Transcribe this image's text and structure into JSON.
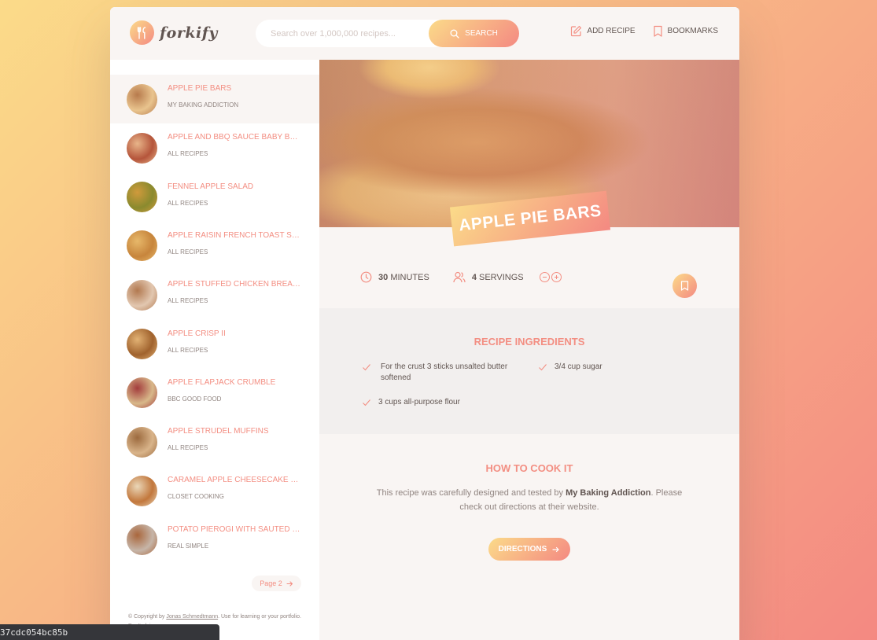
{
  "brand": {
    "name": "forkify"
  },
  "search": {
    "placeholder": "Search over 1,000,000 recipes...",
    "button_label": "SEARCH"
  },
  "nav": {
    "add_recipe": "ADD RECIPE",
    "bookmarks": "BOOKMARKS"
  },
  "results": [
    {
      "title": "APPLE PIE BARS",
      "publisher": "MY BAKING ADDICTION",
      "active": true,
      "thumb": [
        "#e9c48e",
        "#b77a4c"
      ]
    },
    {
      "title": "APPLE AND BBQ SAUCE BABY BA...",
      "publisher": "ALL RECIPES",
      "thumb": [
        "#b5553b",
        "#e8b58a"
      ]
    },
    {
      "title": "FENNEL APPLE SALAD",
      "publisher": "ALL RECIPES",
      "thumb": [
        "#8a8a2e",
        "#d09a3c"
      ]
    },
    {
      "title": "APPLE RAISIN FRENCH TOAST ST...",
      "publisher": "ALL RECIPES",
      "thumb": [
        "#c7853c",
        "#e7b86a"
      ]
    },
    {
      "title": "APPLE STUFFED CHICKEN BREAST",
      "publisher": "ALL RECIPES",
      "thumb": [
        "#e2c7b0",
        "#b27950"
      ]
    },
    {
      "title": "APPLE CRISP II",
      "publisher": "ALL RECIPES",
      "thumb": [
        "#a0622d",
        "#e2b274"
      ]
    },
    {
      "title": "APPLE FLAPJACK CRUMBLE",
      "publisher": "BBC GOOD FOOD",
      "thumb": [
        "#d8b88a",
        "#a33c3c"
      ]
    },
    {
      "title": "APPLE STRUDEL MUFFINS",
      "publisher": "ALL RECIPES",
      "thumb": [
        "#d9b48a",
        "#9c6a3e"
      ]
    },
    {
      "title": "CARAMEL APPLE CHEESECAKE B...",
      "publisher": "CLOSET COOKING",
      "thumb": [
        "#c2773c",
        "#ead7b8"
      ]
    },
    {
      "title": "POTATO PIEROGI WITH SAUTED C...",
      "publisher": "REAL SIMPLE",
      "thumb": [
        "#c6b5a8",
        "#a9663c"
      ]
    }
  ],
  "pagination": {
    "next_label": "Page 2"
  },
  "copyright": {
    "prefix": "© Copyright by ",
    "author": "Jonas Schmedtmann",
    "suffix": ". Use for learning or your portfolio. Don't claim as your own."
  },
  "recipe": {
    "title": "APPLE PIE BARS",
    "cooking_time": "30",
    "cooking_time_unit": "MINUTES",
    "servings": "4",
    "servings_unit": "SERVINGS",
    "ingredients_heading": "RECIPE INGREDIENTS",
    "ingredients": [
      "For the crust 3 sticks unsalted butter softened",
      "3/4 cup sugar",
      "3 cups all-purpose flour"
    ],
    "how_heading": "HOW TO COOK IT",
    "how_prefix": "This recipe was carefully designed and tested by ",
    "publisher": "My Baking Addiction",
    "how_suffix": ". Please check out directions at their website.",
    "directions_label": "DIRECTIONS"
  },
  "status_bar": {
    "text": "37cdc054bc85b"
  },
  "colors": {
    "accent": "#f38e82",
    "gradient_start": "#fbdb89",
    "gradient_end": "#f48982"
  }
}
